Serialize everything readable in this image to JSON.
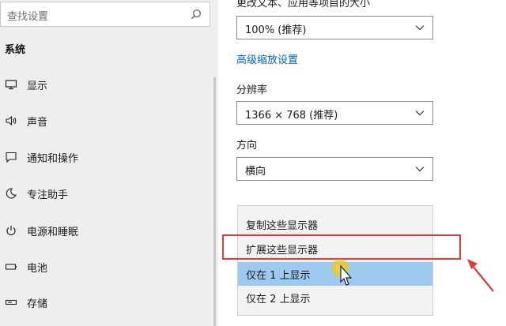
{
  "search": {
    "placeholder": "查找设置"
  },
  "sidebar": {
    "section": "系统",
    "items": [
      {
        "label": "显示",
        "icon": "monitor-icon"
      },
      {
        "label": "声音",
        "icon": "speaker-icon"
      },
      {
        "label": "通知和操作",
        "icon": "notification-icon"
      },
      {
        "label": "专注助手",
        "icon": "moon-icon"
      },
      {
        "label": "电源和睡眠",
        "icon": "power-icon"
      },
      {
        "label": "电池",
        "icon": "battery-icon"
      },
      {
        "label": "存储",
        "icon": "storage-icon"
      }
    ]
  },
  "display": {
    "scale_heading": "更改文本、应用等项目的大小",
    "scale_value": "100% (推荐)",
    "advanced_scaling_link": "高级缩放设置",
    "resolution_label": "分辨率",
    "resolution_value": "1366 × 768 (推荐)",
    "orientation_label": "方向",
    "orientation_value": "横向"
  },
  "multiple_displays_menu": {
    "options": [
      {
        "label": "复制这些显示器"
      },
      {
        "label": "扩展这些显示器"
      },
      {
        "label": "仅在 1 上显示",
        "selected": true
      },
      {
        "label": "仅在 2 上显示"
      }
    ]
  },
  "colors": {
    "accent_link": "#0063b1",
    "selected_option": "#9ec9f0",
    "annotation_red": "#e23b3b"
  }
}
